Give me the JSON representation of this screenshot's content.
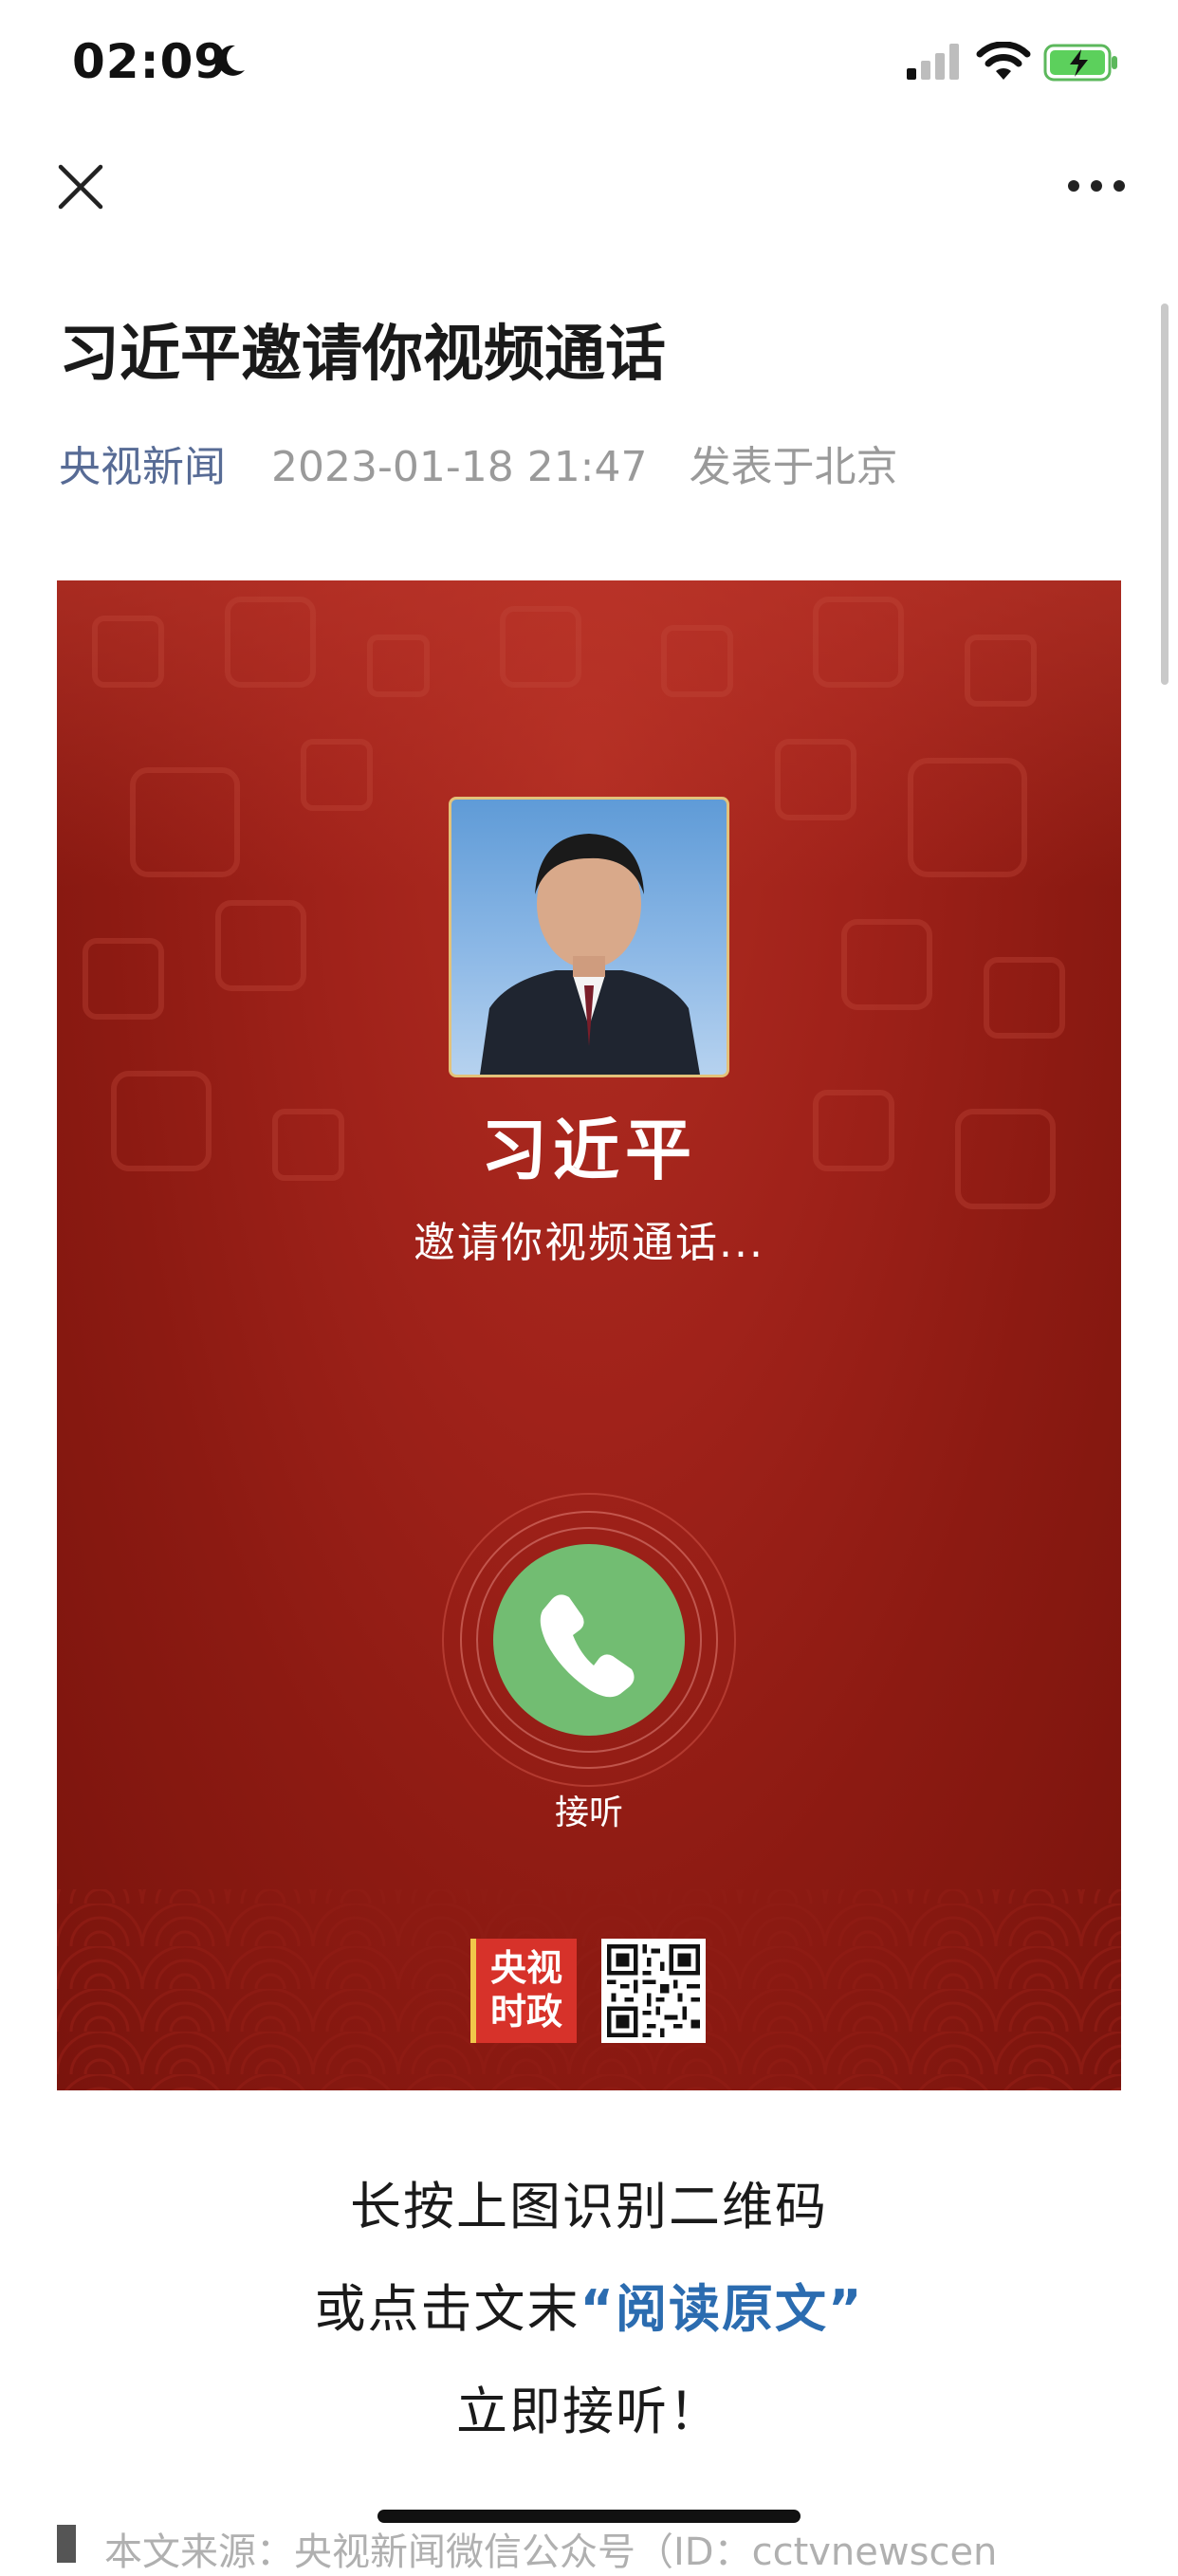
{
  "status_bar": {
    "time": "02:09"
  },
  "article": {
    "title": "习近平邀请你视频通话",
    "author": "央视新闻",
    "date": "2023-01-18 21:47",
    "location": "发表于北京"
  },
  "poster": {
    "caller_name": "习近平",
    "caller_subtitle": "邀请你视频通话...",
    "answer_label": "接听",
    "logo_top": "央视",
    "logo_bottom": "时政",
    "background_color": "#a0221a",
    "answer_color": "#72bd72"
  },
  "body": {
    "line1": "长按上图识别二维码",
    "line2_prefix": "或点击文末",
    "line2_link": "“阅读原文”",
    "line3": "立即接听！",
    "source_text": "本文来源：央视新闻微信公众号（ID：cctvnewscen"
  },
  "icons": {
    "close": "close-icon",
    "more": "more-icon",
    "phone": "phone-icon",
    "moon": "moon-icon",
    "signal": "signal-icon",
    "wifi": "wifi-icon",
    "battery": "battery-charging-icon"
  }
}
